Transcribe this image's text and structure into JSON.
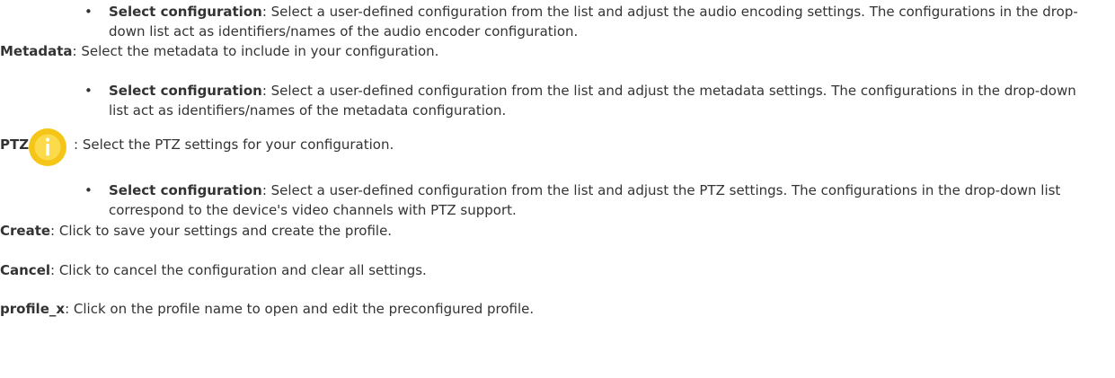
{
  "audio_bullet": {
    "term": "Select configuration",
    "text": ": Select a user-defined configuration from the list and adjust the audio encoding settings. The configurations in the drop-down list act as identifiers/names of the audio encoder configuration."
  },
  "metadata": {
    "term": "Metadata",
    "text": ": Select the metadata to include in your configuration.",
    "bullet_term": "Select configuration",
    "bullet_text": ": Select a user-defined configuration from the list and adjust the metadata settings. The configurations in the drop-down list act as identifiers/names of the metadata configuration."
  },
  "ptz": {
    "term": "PTZ",
    "icon": "info-icon",
    "icon_color": "#f5c518",
    "text": ": Select the PTZ settings for your configuration.",
    "bullet_term": "Select configuration",
    "bullet_text": ": Select a user-defined configuration from the list and adjust the PTZ settings. The configurations in the drop-down list correspond to the device's video channels with PTZ support."
  },
  "create": {
    "term": "Create",
    "text": ": Click to save your settings and create the profile."
  },
  "cancel": {
    "term": "Cancel",
    "text": ": Click to cancel the configuration and clear all settings."
  },
  "profile": {
    "term": "profile_x",
    "text": ": Click on the profile name to open and edit the preconfigured profile."
  }
}
